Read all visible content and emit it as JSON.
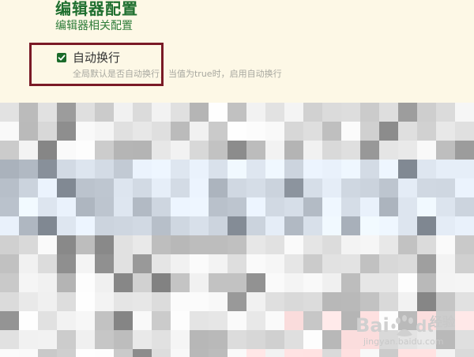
{
  "section": {
    "title": "编辑器配置",
    "subtitle": "编辑器相关配置"
  },
  "setting": {
    "checked": true,
    "label": "自动换行",
    "description": "全局默认是否自动换行，当值为true时，启用自动换行"
  },
  "colors": {
    "panel_background": "#fdf8e6",
    "title_green": "#1f6f2f",
    "checkbox_green": "#1b6b2a",
    "highlight_border": "#7a1a26"
  },
  "watermark": {
    "brand": "Bai du",
    "label": "经验",
    "url": "jingyan.baidu.com"
  },
  "icons": {
    "checkbox": "checkmark-icon",
    "watermark": "baidu-paw-logo"
  }
}
